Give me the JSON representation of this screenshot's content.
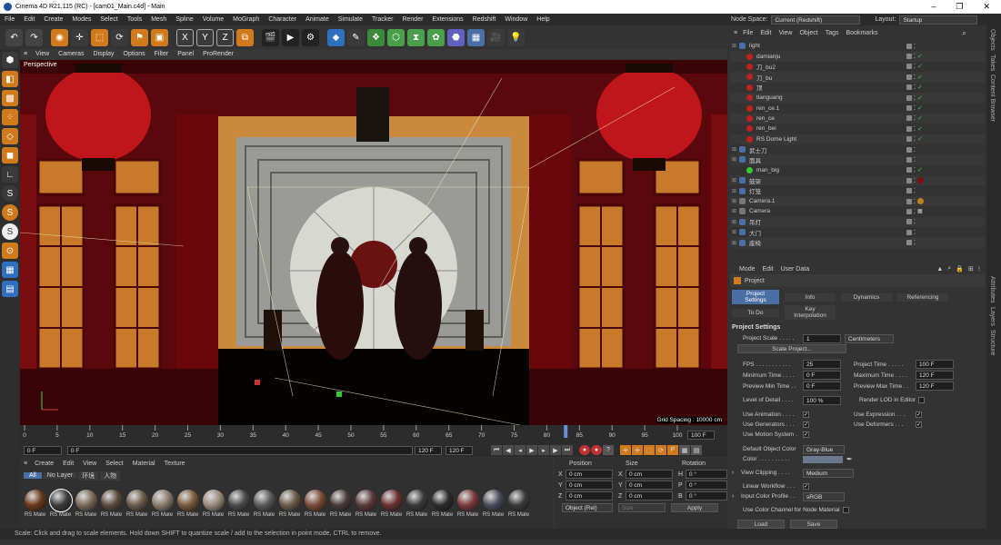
{
  "app": {
    "title": "Cinema 4D R21.115 (RC) - [cam01_Main.c4d] - Main"
  },
  "menus": [
    "File",
    "Edit",
    "Create",
    "Modes",
    "Select",
    "Tools",
    "Mesh",
    "Spline",
    "Volume",
    "MoGraph",
    "Character",
    "Animate",
    "Simulate",
    "Tracker",
    "Render",
    "Extensions",
    "Redshift",
    "Window",
    "Help"
  ],
  "node_space": {
    "label": "Node Space:",
    "value": "Current (Redshift)"
  },
  "layout": {
    "label": "Layout:",
    "value": "Startup"
  },
  "viewport": {
    "menus": [
      "View",
      "Cameras",
      "Display",
      "Options",
      "Filter",
      "Panel",
      "ProRender"
    ],
    "label": "Perspective",
    "grid": "Grid Spacing : 10000 cm"
  },
  "timeline": {
    "ticks": [
      "0",
      "5",
      "10",
      "15",
      "20",
      "25",
      "30",
      "35",
      "40",
      "45",
      "50",
      "55",
      "60",
      "65",
      "70",
      "75",
      "80",
      "85",
      "90",
      "95",
      "100"
    ],
    "current": "100 F",
    "start": "0 F",
    "min": "0 F",
    "end": "120 F",
    "max": "120 F",
    "playhead": 0.829
  },
  "materials": {
    "menus": [
      "Create",
      "Edit",
      "View",
      "Select",
      "Material",
      "Texture"
    ],
    "filters": [
      "All",
      "No Layer",
      "环境",
      "人物"
    ],
    "label": "RS Mate",
    "count": 20
  },
  "coords": {
    "headers": [
      "Position",
      "Size",
      "Rotation"
    ],
    "rows": [
      {
        "axis": "X",
        "pos": "0 cm",
        "size": "0 cm",
        "rot_axis": "H",
        "rot": "0 °"
      },
      {
        "axis": "Y",
        "pos": "0 cm",
        "size": "0 cm",
        "rot_axis": "P",
        "rot": "0 °"
      },
      {
        "axis": "Z",
        "pos": "0 cm",
        "size": "0 cm",
        "rot_axis": "B",
        "rot": "0 °"
      }
    ],
    "mode": "Object (Rel)",
    "size_mode": "Size",
    "apply": "Apply"
  },
  "status": "Scale: Click and drag to scale elements. Hold down SHIFT to quantize scale / add to the selection in point mode, CTRL to remove.",
  "objmgr": {
    "menus": [
      "File",
      "Edit",
      "View",
      "Object",
      "Tags",
      "Bookmarks"
    ],
    "objects": [
      {
        "name": "light",
        "indent": 0,
        "icon": "layer",
        "tag": ""
      },
      {
        "name": "damianju",
        "indent": 1,
        "icon": "rs",
        "tag": "ok"
      },
      {
        "name": "刀_bu2",
        "indent": 1,
        "icon": "rs",
        "tag": "ok"
      },
      {
        "name": "刀_bu",
        "indent": 1,
        "icon": "rs",
        "tag": "ok"
      },
      {
        "name": "顶",
        "indent": 1,
        "icon": "rs",
        "tag": "ok"
      },
      {
        "name": "tianguang",
        "indent": 1,
        "icon": "rs",
        "tag": "ok"
      },
      {
        "name": "ren_ce.1",
        "indent": 1,
        "icon": "rs",
        "tag": "ok"
      },
      {
        "name": "ren_ce",
        "indent": 1,
        "icon": "rs",
        "tag": "ok"
      },
      {
        "name": "ren_bei",
        "indent": 1,
        "icon": "rs",
        "tag": "ok"
      },
      {
        "name": "RS Dome Light",
        "indent": 1,
        "icon": "rs",
        "tag": "ok"
      },
      {
        "name": "武士刀",
        "indent": 0,
        "icon": "layer",
        "tag": ""
      },
      {
        "name": "面具",
        "indent": 0,
        "icon": "layer",
        "tag": ""
      },
      {
        "name": "man_big",
        "indent": 1,
        "icon": "null",
        "tag": "ok"
      },
      {
        "name": "鼓架",
        "indent": 0,
        "icon": "layer",
        "tag": "mat"
      },
      {
        "name": "灯笼",
        "indent": 0,
        "icon": "layer",
        "tag": ""
      },
      {
        "name": "Camera.1",
        "indent": 0,
        "icon": "cam",
        "tag": "cam"
      },
      {
        "name": "Camera",
        "indent": 0,
        "icon": "cam",
        "tag": "grid"
      },
      {
        "name": "吊灯",
        "indent": 0,
        "icon": "layer",
        "tag": ""
      },
      {
        "name": "大门",
        "indent": 0,
        "icon": "layer",
        "tag": ""
      },
      {
        "name": "座椅",
        "indent": 0,
        "icon": "layer",
        "tag": ""
      }
    ]
  },
  "attrs": {
    "menus": [
      "Mode",
      "Edit",
      "User Data"
    ],
    "title": "Project",
    "tabs": [
      "Project Settings",
      "Info",
      "Dynamics",
      "Referencing"
    ],
    "tabs2": [
      "To Do",
      "Key Interpolation"
    ],
    "section": "Project Settings",
    "project_scale": {
      "label": "Project Scale . . . . .",
      "value": "1",
      "unit": "Centimeters"
    },
    "scale_btn": "Scale Project...",
    "left": [
      {
        "l": "FPS . . . . . . . . . . .",
        "v": "25"
      },
      {
        "l": "Minimum Time . . . .",
        "v": "0 F"
      },
      {
        "l": "Preview Min Time . .",
        "v": "0 F"
      }
    ],
    "right": [
      {
        "l": "Project Time . . . . .",
        "v": "100 F"
      },
      {
        "l": "Maximum Time . . . .",
        "v": "120 F"
      },
      {
        "l": "Preview Max Time . .",
        "v": "120 F"
      }
    ],
    "lod": {
      "label": "Level of Detail . . . .",
      "value": "100 %"
    },
    "render_lod": "Render LOD in Editor",
    "checks_l": [
      "Use Animation . . . .",
      "Use Generators . . .",
      "Use Motion System ."
    ],
    "checks_r": [
      "Use Expression . . .",
      "Use Deformers . . ."
    ],
    "obj_color": {
      "label": "Default Object Color",
      "value": "Gray-Blue"
    },
    "color": "Color . . . . . . . . . .",
    "view_clip": {
      "label": "View Clipping . . . .",
      "value": "Medium"
    },
    "linear": "Linear Workflow . . .",
    "icp": {
      "label": "Input Color Profile . .",
      "value": "sRGB"
    },
    "cc": "Use Color Channel for Node Material",
    "load": "Load Preset...",
    "save": "Save Preset..."
  },
  "side_tabs": [
    "Objects",
    "Takes",
    "Content Browser",
    "Attributes",
    "Layers",
    "Structure"
  ],
  "colors": {
    "accent": "#4a6fa5",
    "red_wall": "#7a0c10",
    "lantern": "#c0151b",
    "wood": "#c87a2a"
  }
}
